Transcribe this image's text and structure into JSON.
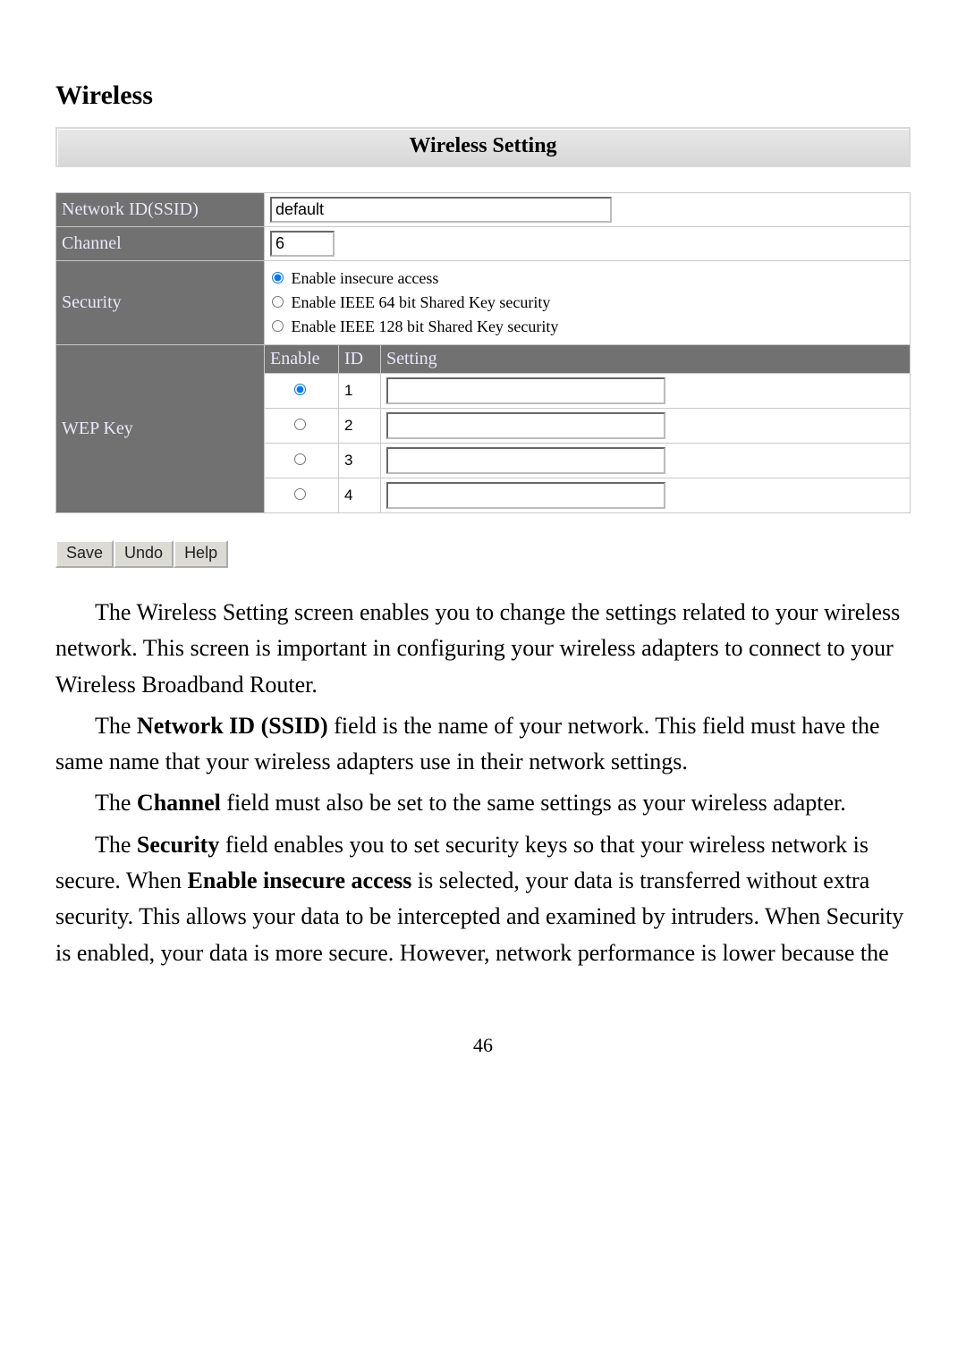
{
  "section_title": "Wireless",
  "panel_title": "Wireless Setting",
  "labels": {
    "ssid": "Network ID(SSID)",
    "channel": "Channel",
    "security": "Security",
    "wep": "WEP Key"
  },
  "fields": {
    "ssid_value": "default",
    "channel_value": "6"
  },
  "security_options": {
    "opt1": "Enable insecure access",
    "opt2": "Enable IEEE 64 bit Shared Key security",
    "opt3": "Enable IEEE 128 bit Shared Key security",
    "selected": 0
  },
  "wep_headers": {
    "enable": "Enable",
    "id": "ID",
    "setting": "Setting"
  },
  "wep_keys": [
    {
      "id": "1",
      "selected": true,
      "value": ""
    },
    {
      "id": "2",
      "selected": false,
      "value": ""
    },
    {
      "id": "3",
      "selected": false,
      "value": ""
    },
    {
      "id": "4",
      "selected": false,
      "value": ""
    }
  ],
  "buttons": {
    "save": "Save",
    "undo": "Undo",
    "help": "Help"
  },
  "body": {
    "p1a": "The Wireless Setting screen enables you to change the settings related to your wireless network. This screen is important in configuring your wireless adapters to connect to your Wireless Broadband Router.",
    "p2_pre": "The ",
    "p2_b": "Network ID (SSID)",
    "p2_post": " field is the name of your network. This field must have the same name that your wireless adapters use in their network settings.",
    "p3_pre": "The ",
    "p3_b": "Channel",
    "p3_post": " field must also be set to the same settings as your wireless adapter.",
    "p4_pre": "The ",
    "p4_b1": "Security",
    "p4_mid": " field enables you to set security keys so that your wireless network is secure. When ",
    "p4_b2": "Enable insecure access",
    "p4_post": " is selected, your data is transferred without extra security. This allows your data to be intercepted and examined by intruders. When Security is enabled, your data is more secure. However, network performance is lower because the"
  },
  "page_number": "46"
}
